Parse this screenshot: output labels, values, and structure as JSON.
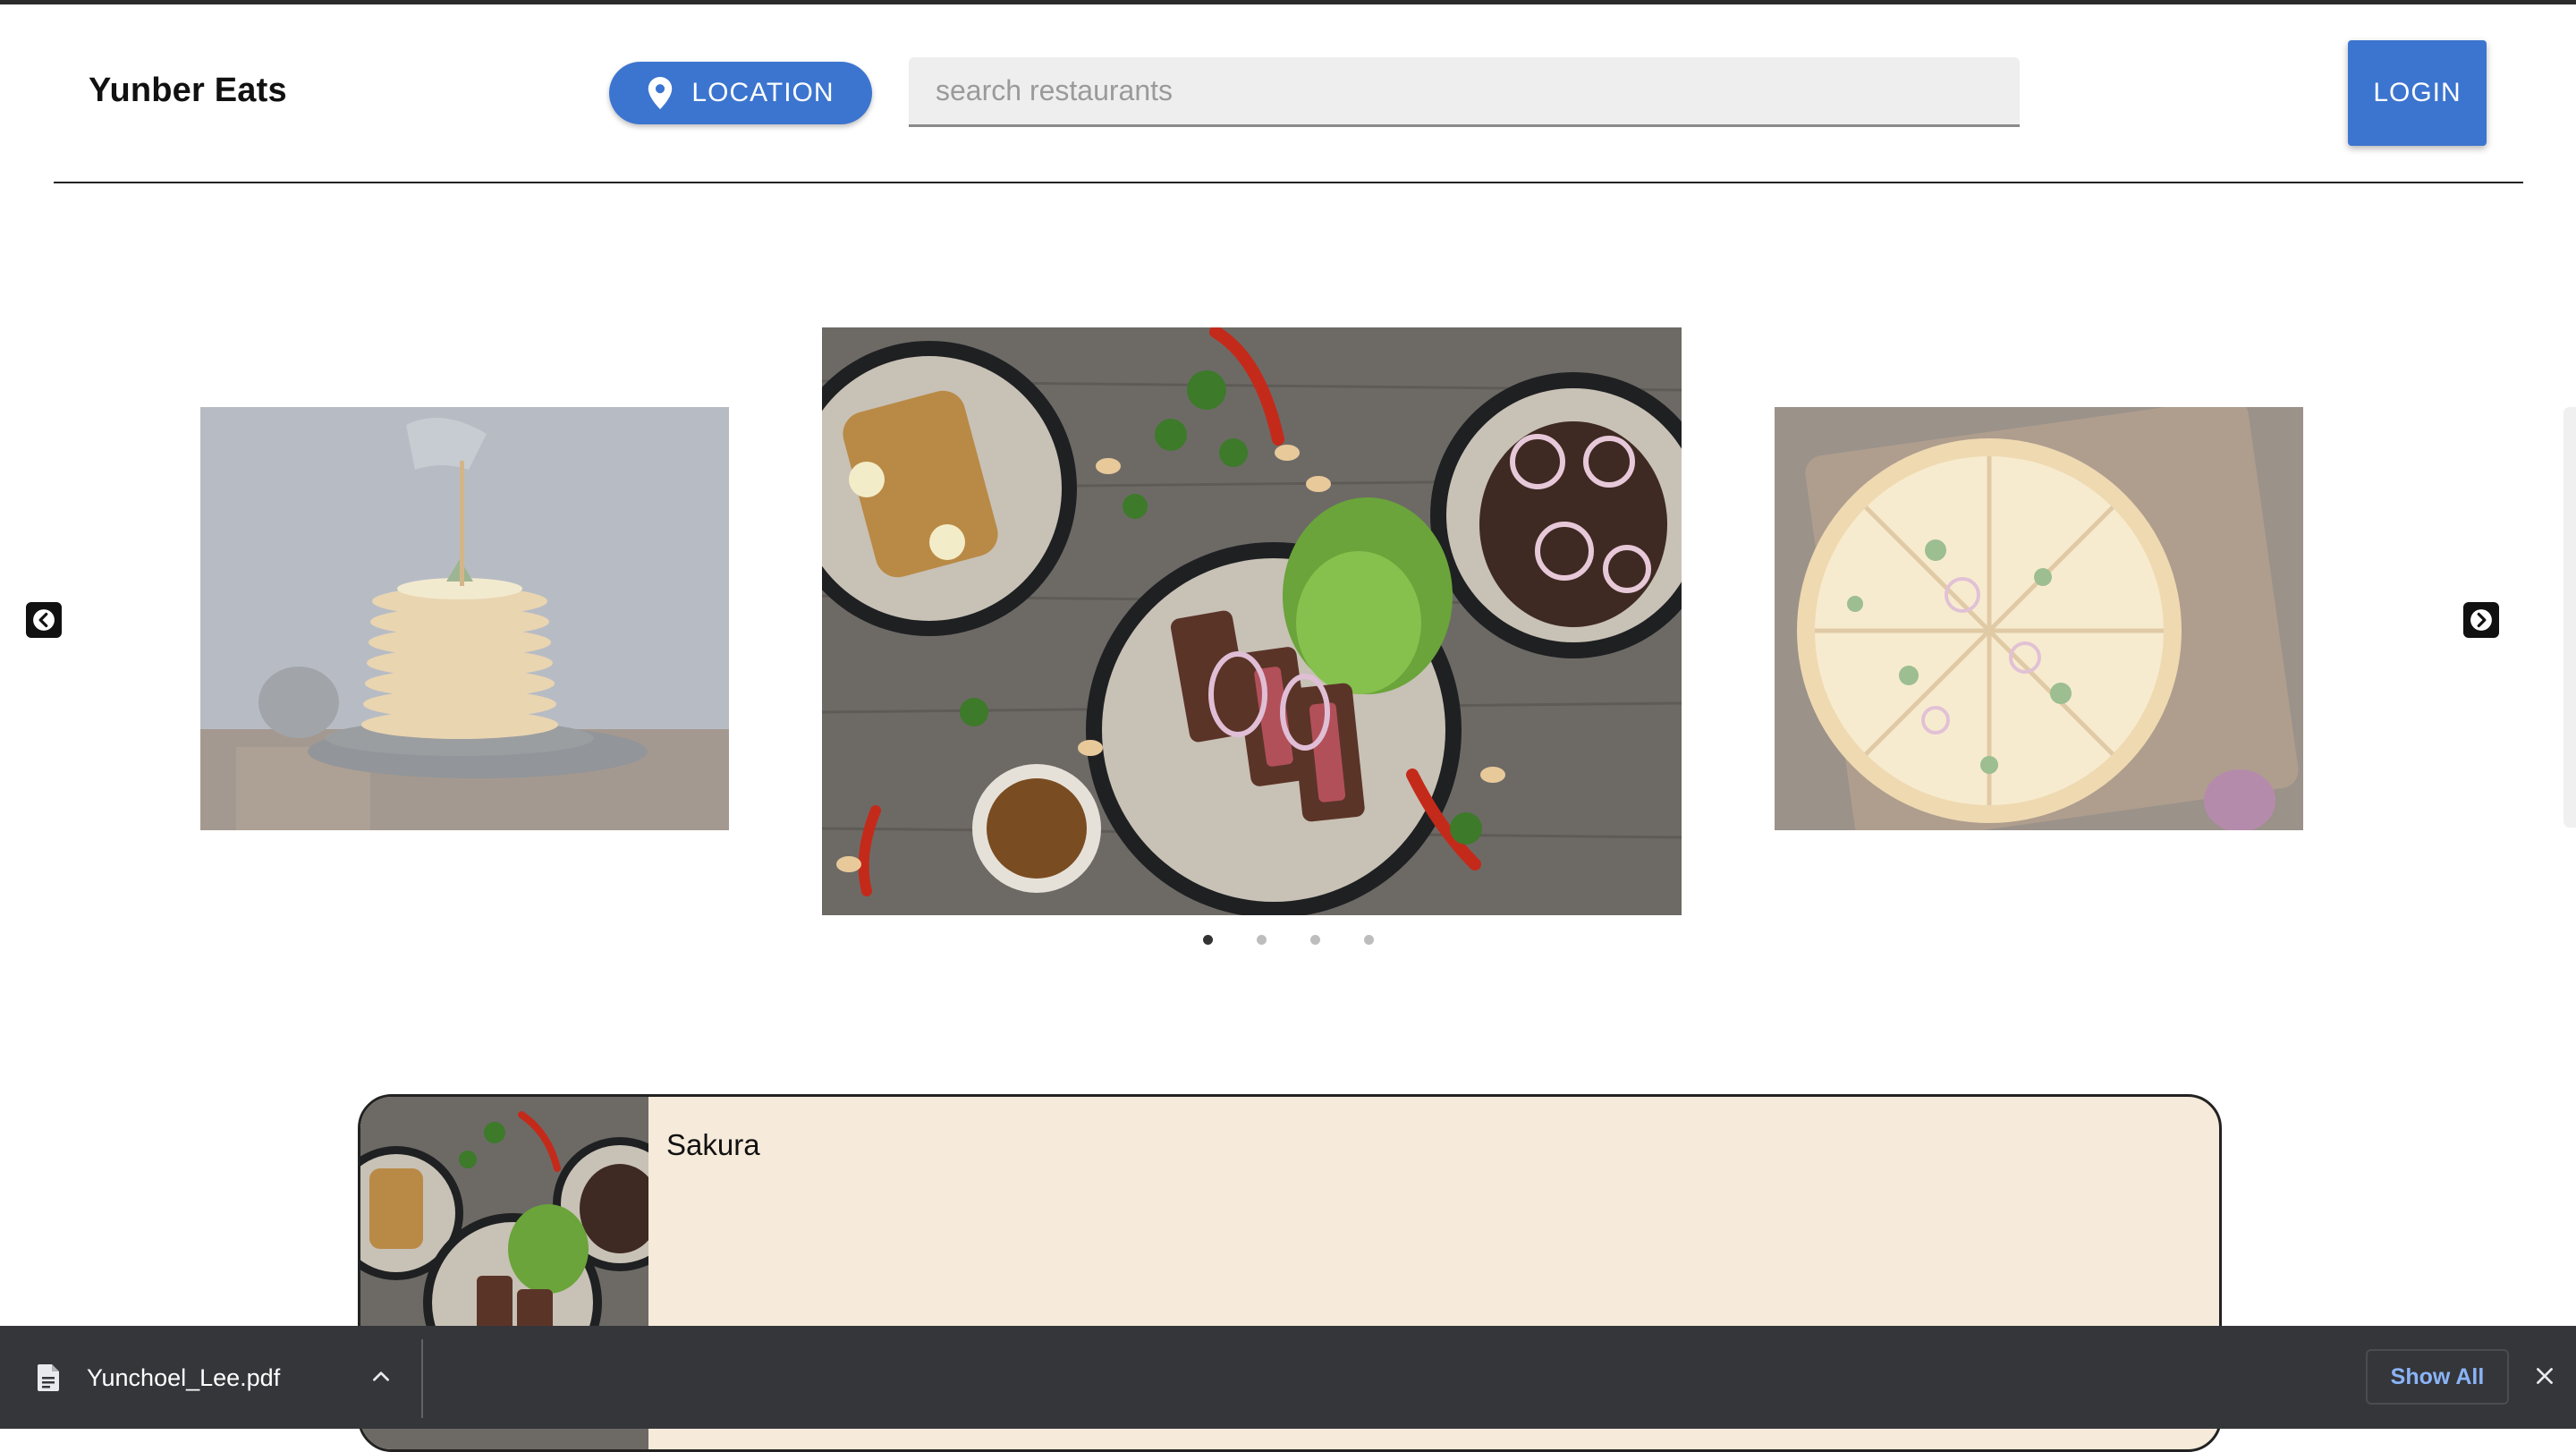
{
  "header": {
    "brand": "Yunber Eats",
    "location_button_label": "LOCATION",
    "location_icon": "map-pin-icon",
    "search_placeholder": "search restaurants",
    "search_value": "",
    "login_label": "LOGIN"
  },
  "carousel": {
    "slides": [
      {
        "depicts": "pancake-stack-with-syrup",
        "state": "previous"
      },
      {
        "depicts": "steak-salad-bowls",
        "state": "active"
      },
      {
        "depicts": "sliced-pizza-on-board",
        "state": "next"
      }
    ],
    "prev_icon": "chevron-left-icon",
    "next_icon": "chevron-right-icon",
    "dot_count": 4,
    "active_dot": 0
  },
  "restaurants": [
    {
      "name": "Sakura",
      "thumbnail": "steak-salad-bowls"
    }
  ],
  "download_shelf": {
    "file_name": "Yunchoel_Lee.pdf",
    "file_icon": "document-icon",
    "show_all_label": "Show All",
    "close_icon": "close-icon"
  },
  "colors": {
    "accent": "#3c75cf",
    "card_background": "#f6eada",
    "shelf_background": "#35363a",
    "show_all_text": "#8ab4f8"
  }
}
